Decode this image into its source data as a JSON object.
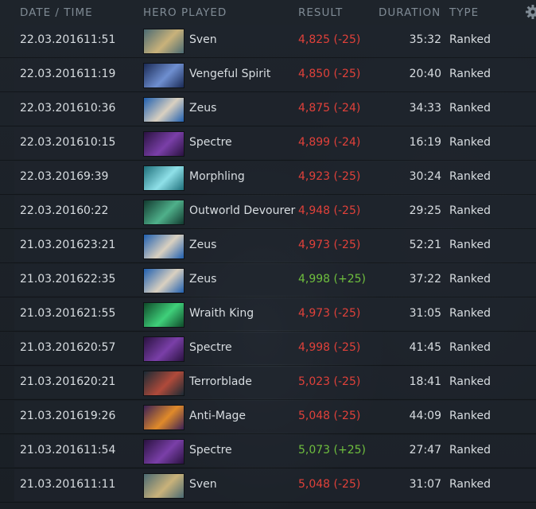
{
  "header": {
    "date_time": "DATE / TIME",
    "hero_played": "HERO PLAYED",
    "result": "RESULT",
    "duration": "DURATION",
    "type": "TYPE"
  },
  "matches": [
    {
      "date": "22.03.2016",
      "time": "11:51",
      "hero": "Sven",
      "result": "4,825 (-25)",
      "outcome": "loss",
      "duration": "35:32",
      "type": "Ranked",
      "hero_colors": [
        "#4a6a73",
        "#c9b27a"
      ]
    },
    {
      "date": "22.03.2016",
      "time": "11:19",
      "hero": "Vengeful Spirit",
      "result": "4,850 (-25)",
      "outcome": "loss",
      "duration": "20:40",
      "type": "Ranked",
      "hero_colors": [
        "#1a2a55",
        "#6f8fd0"
      ]
    },
    {
      "date": "22.03.2016",
      "time": "10:36",
      "hero": "Zeus",
      "result": "4,875 (-24)",
      "outcome": "loss",
      "duration": "34:33",
      "type": "Ranked",
      "hero_colors": [
        "#1f5fb0",
        "#d9d0c0"
      ]
    },
    {
      "date": "22.03.2016",
      "time": "10:15",
      "hero": "Spectre",
      "result": "4,899 (-24)",
      "outcome": "loss",
      "duration": "16:19",
      "type": "Ranked",
      "hero_colors": [
        "#2a1240",
        "#7a3fa8"
      ]
    },
    {
      "date": "22.03.2016",
      "time": "9:39",
      "hero": "Morphling",
      "result": "4,923 (-25)",
      "outcome": "loss",
      "duration": "30:24",
      "type": "Ranked",
      "hero_colors": [
        "#1e6f7a",
        "#8fe0e8"
      ]
    },
    {
      "date": "22.03.2016",
      "time": "0:22",
      "hero": "Outworld Devourer",
      "result": "4,948 (-25)",
      "outcome": "loss",
      "duration": "29:25",
      "type": "Ranked",
      "hero_colors": [
        "#123a30",
        "#4fb08a"
      ]
    },
    {
      "date": "21.03.2016",
      "time": "23:21",
      "hero": "Zeus",
      "result": "4,973 (-25)",
      "outcome": "loss",
      "duration": "52:21",
      "type": "Ranked",
      "hero_colors": [
        "#1f5fb0",
        "#d9d0c0"
      ]
    },
    {
      "date": "21.03.2016",
      "time": "22:35",
      "hero": "Zeus",
      "result": "4,998 (+25)",
      "outcome": "win",
      "duration": "37:22",
      "type": "Ranked",
      "hero_colors": [
        "#1f5fb0",
        "#d9d0c0"
      ]
    },
    {
      "date": "21.03.2016",
      "time": "21:55",
      "hero": "Wraith King",
      "result": "4,973 (-25)",
      "outcome": "loss",
      "duration": "31:05",
      "type": "Ranked",
      "hero_colors": [
        "#0f4a2a",
        "#3fd07a"
      ]
    },
    {
      "date": "21.03.2016",
      "time": "20:57",
      "hero": "Spectre",
      "result": "4,998 (-25)",
      "outcome": "loss",
      "duration": "41:45",
      "type": "Ranked",
      "hero_colors": [
        "#2a1240",
        "#7a3fa8"
      ]
    },
    {
      "date": "21.03.2016",
      "time": "20:21",
      "hero": "Terrorblade",
      "result": "5,023 (-25)",
      "outcome": "loss",
      "duration": "18:41",
      "type": "Ranked",
      "hero_colors": [
        "#1a2a35",
        "#b04a3a"
      ]
    },
    {
      "date": "21.03.2016",
      "time": "19:26",
      "hero": "Anti-Mage",
      "result": "5,048 (-25)",
      "outcome": "loss",
      "duration": "44:09",
      "type": "Ranked",
      "hero_colors": [
        "#3a2055",
        "#e08a2a"
      ]
    },
    {
      "date": "21.03.2016",
      "time": "11:54",
      "hero": "Spectre",
      "result": "5,073 (+25)",
      "outcome": "win",
      "duration": "27:47",
      "type": "Ranked",
      "hero_colors": [
        "#2a1240",
        "#7a3fa8"
      ]
    },
    {
      "date": "21.03.2016",
      "time": "11:11",
      "hero": "Sven",
      "result": "5,048 (-25)",
      "outcome": "loss",
      "duration": "31:07",
      "type": "Ranked",
      "hero_colors": [
        "#4a6a73",
        "#c9b27a"
      ]
    }
  ],
  "colors": {
    "loss": "#e0413a",
    "win": "#6fbf3e",
    "text": "#d8dde1",
    "header": "#7f8a94"
  },
  "icons": {
    "settings": "gear-icon"
  }
}
